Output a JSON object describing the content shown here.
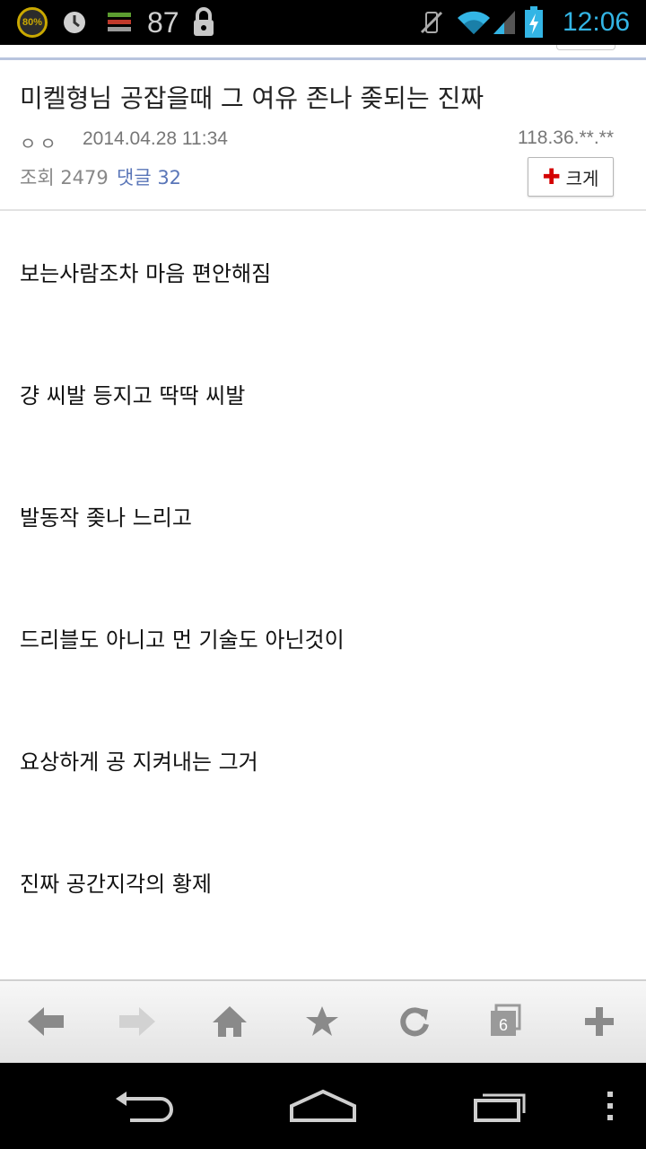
{
  "status_bar": {
    "battery_ring_label": "80%",
    "notification_count": "87",
    "time": "12:06"
  },
  "post": {
    "title": "미켈형님 공잡을때 그 여유 존나 좆되는 진짜",
    "nickname": "ㅇㅇ",
    "date": "2014.04.28 11:34",
    "ip": "118.36.**.**",
    "views_label": "조회 2479",
    "comments_label": "댓글 32",
    "enlarge_label": "크게",
    "lines": [
      "보는사람조차 마음 편안해짐",
      "걍 씨발 등지고 딱딱 씨발",
      "발동작 좆나 느리고",
      "드리블도 아니고 먼 기술도 아닌것이",
      "요상하게 공 지켜내는 그거",
      "진짜 공간지각의 황제"
    ]
  },
  "toolbar": {
    "tab_count": "6",
    "icons": [
      "back-arrow-icon",
      "forward-arrow-icon",
      "home-icon",
      "star-icon",
      "refresh-icon",
      "tabs-icon",
      "plus-icon"
    ]
  },
  "navbar": {
    "icons": [
      "back-icon",
      "home-icon",
      "recent-apps-icon",
      "menu-icon"
    ]
  },
  "colors": {
    "accent_blue": "#33b5e5",
    "comment_link": "#5a76b8",
    "enlarge_plus": "#d40000",
    "rule_blue": "#b8c4de"
  }
}
